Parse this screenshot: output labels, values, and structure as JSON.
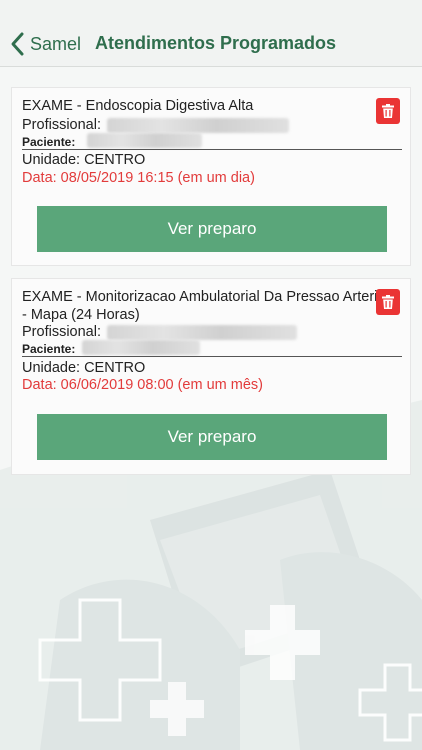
{
  "header": {
    "back_label": "Samel",
    "title": "Atendimentos Programados"
  },
  "appointments": [
    {
      "exam": "EXAME - Endoscopia Digestiva Alta",
      "professional_label": "Profissional:",
      "patient_label": "Paciente:",
      "unit": "Unidade: CENTRO",
      "date": "Data: 08/05/2019 16:15 (em um dia)",
      "button_label": "Ver preparo"
    },
    {
      "exam": "EXAME - Monitorizacao Ambulatorial Da Pressao Arteri - Mapa (24 Horas)",
      "professional_label": "Profissional:",
      "patient_label": "Paciente:",
      "unit": "Unidade: CENTRO",
      "date": "Data: 06/06/2019 08:00 (em um mês)",
      "button_label": "Ver preparo"
    }
  ],
  "colors": {
    "brand_green": "#2f6e4d",
    "button_green": "#5aa67a",
    "date_red": "#e23b3b",
    "trash_red": "#ea3434"
  }
}
